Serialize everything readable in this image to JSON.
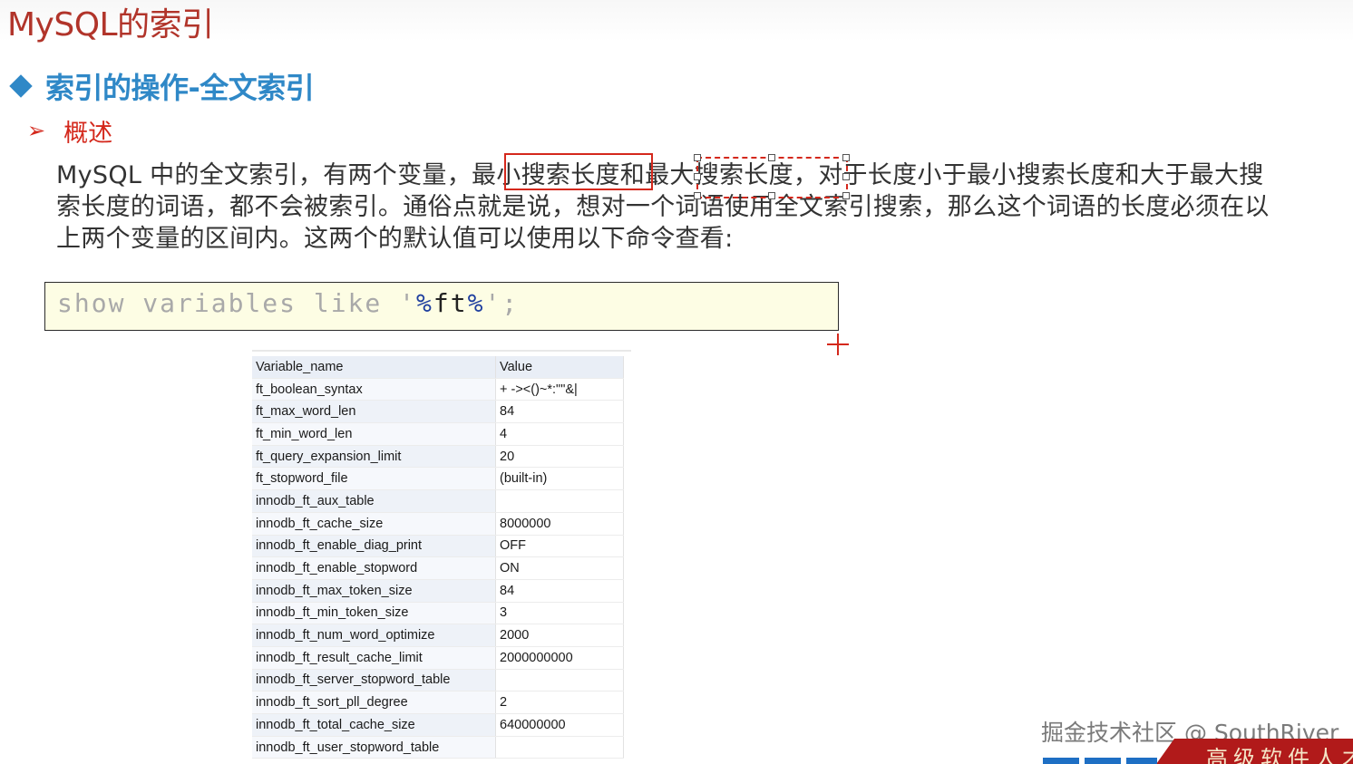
{
  "page_title": "MySQL的索引",
  "section": {
    "title": "索引的操作-全文索引"
  },
  "subsection": {
    "title": "概述"
  },
  "paragraph": {
    "line1": "MySQL 中的全文索引，有两个变量，最小搜索长度和最大搜索长度，对于长度小于最小搜索长度和大于最大搜",
    "line2": "索长度的词语，都不会被索引。通俗点就是说，想对一个词语使用全文索引搜索，那么这个词语的长度必须在以",
    "line3": "上两个变量的区间内。这两个的默认值可以使用以下命令查看:"
  },
  "code": {
    "p1": "show variables like '",
    "p2": "%",
    "p3": "ft",
    "p4": "%",
    "p5": "';"
  },
  "table": {
    "headers": [
      "Variable_name",
      "Value"
    ],
    "rows": [
      [
        "ft_boolean_syntax",
        "+ -><()~*:\"\"&|"
      ],
      [
        "ft_max_word_len",
        "84"
      ],
      [
        "ft_min_word_len",
        "4"
      ],
      [
        "ft_query_expansion_limit",
        "20"
      ],
      [
        "ft_stopword_file",
        "(built-in)"
      ],
      [
        "innodb_ft_aux_table",
        ""
      ],
      [
        "innodb_ft_cache_size",
        "8000000"
      ],
      [
        "innodb_ft_enable_diag_print",
        "OFF"
      ],
      [
        "innodb_ft_enable_stopword",
        "ON"
      ],
      [
        "innodb_ft_max_token_size",
        "84"
      ],
      [
        "innodb_ft_min_token_size",
        "3"
      ],
      [
        "innodb_ft_num_word_optimize",
        "2000"
      ],
      [
        "innodb_ft_result_cache_limit",
        "2000000000"
      ],
      [
        "innodb_ft_server_stopword_table",
        ""
      ],
      [
        "innodb_ft_sort_pll_degree",
        "2"
      ],
      [
        "innodb_ft_total_cache_size",
        "640000000"
      ],
      [
        "innodb_ft_user_stopword_table",
        ""
      ]
    ]
  },
  "watermark": "掘金技术社区 @ SouthRiver",
  "banner_text": "高级软件人才",
  "colors": {
    "title_red": "#b1342a",
    "accent_blue": "#2f88c7",
    "highlight_red": "#d4281c",
    "code_bg": "#fdfde4"
  }
}
